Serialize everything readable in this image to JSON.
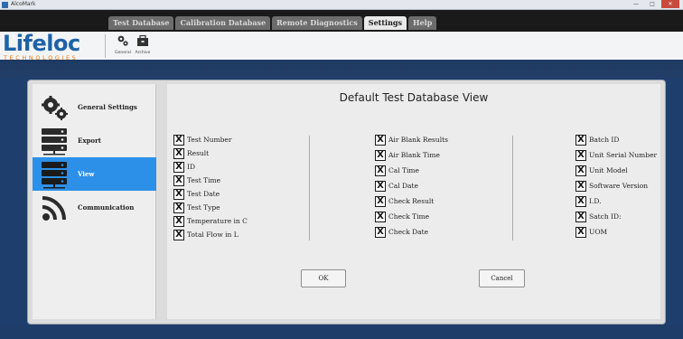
{
  "window": {
    "title": "AlcoMark",
    "minimize_glyph": "—",
    "maximize_glyph": "□",
    "close_glyph": "✕"
  },
  "tabs": [
    {
      "label": "Test Database",
      "active": false
    },
    {
      "label": "Calibration Database",
      "active": false
    },
    {
      "label": "Remote Diagnostics",
      "active": false
    },
    {
      "label": "Settings",
      "active": true
    },
    {
      "label": "Help",
      "active": false
    }
  ],
  "logo": {
    "main": "Lifeloc",
    "sub": "TECHNOLOGIES",
    "colors": {
      "main": "#1d62a8",
      "sub": "#ea7a16"
    }
  },
  "ribbon": [
    {
      "label": "General",
      "icon": "gears-icon"
    },
    {
      "label": "Archive",
      "icon": "archive-icon"
    }
  ],
  "sidebar": {
    "items": [
      {
        "label": "General Settings",
        "icon": "gears-icon",
        "active": false
      },
      {
        "label": "Export",
        "icon": "server-icon",
        "active": false
      },
      {
        "label": "View",
        "icon": "server-icon",
        "active": true
      },
      {
        "label": "Communication",
        "icon": "wireless-icon",
        "active": false
      }
    ],
    "active_color": "#2d90e8"
  },
  "main": {
    "title": "Default Test Database View",
    "check_mark": "X",
    "columns": [
      [
        "Test Number",
        "Result",
        "ID",
        "Test Time",
        "Test Date",
        "Test Type",
        "Temperature in C",
        "Total Flow in L"
      ],
      [
        "Air Blank Results",
        "Air Blank Time",
        "Cal Time",
        "Cal Date",
        "Check Result",
        "Check Time",
        "Check Date"
      ],
      [
        "Batch ID",
        "Unit Serial Number",
        "Unit Model",
        "Software Version",
        "I.D.",
        "Satch ID:",
        "UOM"
      ]
    ],
    "ok_label": "OK",
    "cancel_label": "Cancel"
  }
}
